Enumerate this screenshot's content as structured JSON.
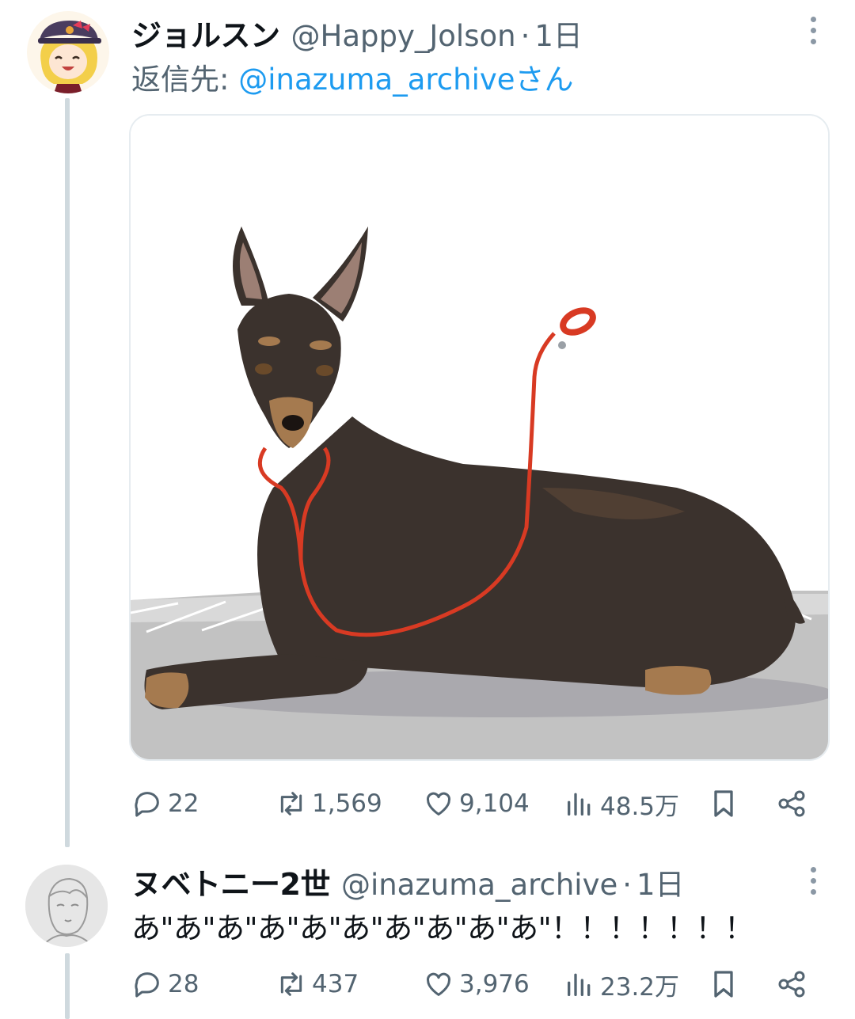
{
  "tweet": {
    "display_name": "ジョルスン",
    "handle": "@Happy_Jolson",
    "separator": "·",
    "time": "1日",
    "reply_prefix": "返信先: ",
    "reply_to_handle": "@inazuma_archive",
    "reply_suffix": "さん",
    "stats": {
      "replies": "22",
      "retweets": "1,569",
      "likes": "9,104",
      "views": "48.5万"
    }
  },
  "reply": {
    "display_name": "ヌベトニー2世",
    "handle": "@inazuma_archive",
    "separator": "·",
    "time": "1日",
    "text": "あ\"あ\"あ\"あ\"あ\"あ\"あ\"あ\"あ\"あ\"！！！！！！！",
    "stats": {
      "replies": "28",
      "retweets": "437",
      "likes": "3,976",
      "views": "23.2万"
    }
  },
  "colors": {
    "text_primary": "#0f1419",
    "text_secondary": "#536471",
    "link": "#1d9bf0",
    "thread_line": "#cfd9de"
  },
  "icons": [
    "more-icon",
    "reply-icon",
    "retweet-icon",
    "like-icon",
    "views-icon",
    "bookmark-icon",
    "share-icon"
  ]
}
